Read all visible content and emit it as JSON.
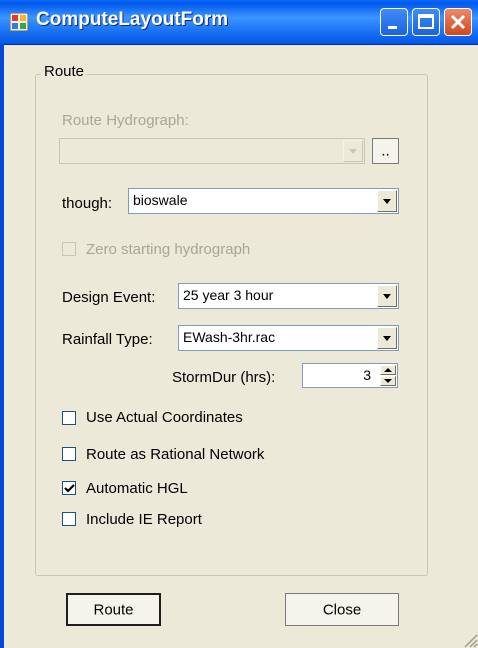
{
  "window": {
    "title": "ComputeLayoutForm"
  },
  "group": {
    "label": "Route"
  },
  "route_hydrograph": {
    "label": "Route Hydrograph:",
    "value": "",
    "browse_label": ".."
  },
  "through": {
    "label": "though:",
    "value": "bioswale"
  },
  "zero_start": {
    "label": "Zero starting hydrograph",
    "checked": false
  },
  "design_event": {
    "label": "Design Event:",
    "value": "25 year 3 hour"
  },
  "rainfall_type": {
    "label": "Rainfall Type:",
    "value": "EWash-3hr.rac"
  },
  "storm_dur": {
    "label": "StormDur (hrs):",
    "value": "3"
  },
  "checkboxes": [
    {
      "label": "Use Actual Coordinates",
      "checked": false
    },
    {
      "label": "Route as Rational Network",
      "checked": false
    },
    {
      "label": "Automatic HGL",
      "checked": true
    },
    {
      "label": "Include IE Report",
      "checked": false
    }
  ],
  "buttons": {
    "route_label": "Route",
    "close_label": "Close"
  }
}
